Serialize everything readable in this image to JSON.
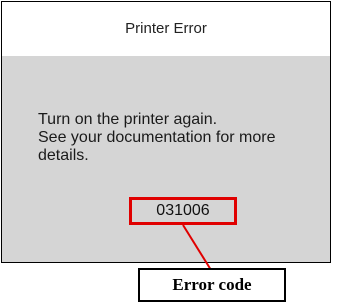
{
  "dialog": {
    "title": "Printer Error",
    "message_lines": [
      "Turn on the printer again.",
      "See your documentation for more",
      "details."
    ],
    "error_code": "031006"
  },
  "annotation": {
    "label": "Error code",
    "highlight_color": "#e00000"
  }
}
